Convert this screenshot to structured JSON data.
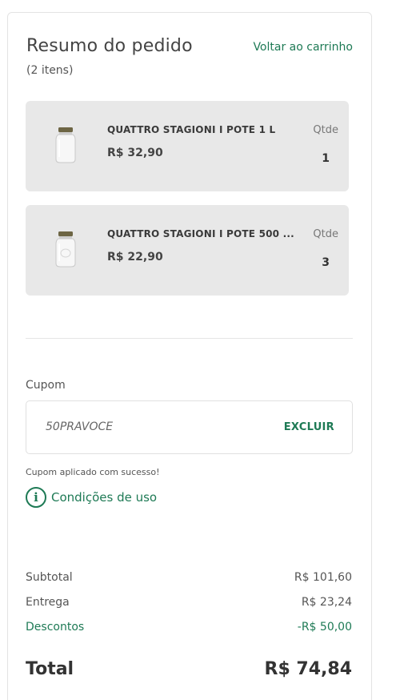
{
  "header": {
    "title": "Resumo do pedido",
    "item_count": "(2 itens)",
    "back_link": "Voltar ao carrinho"
  },
  "items": [
    {
      "name": "QUATTRO STAGIONI I POTE 1 L",
      "price": "R$ 32,90",
      "qty_label": "Qtde",
      "qty": "1",
      "icon": "glass-jar-icon"
    },
    {
      "name": "QUATTRO STAGIONI I POTE 500 ...",
      "price": "R$ 22,90",
      "qty_label": "Qtde",
      "qty": "3",
      "icon": "glass-jar-icon"
    }
  ],
  "coupon": {
    "label": "Cupom",
    "code": "50PRAVOCE",
    "remove_label": "EXCLUIR",
    "success_message": "Cupom aplicado com sucesso!",
    "conditions_label": "Condições de uso"
  },
  "summary": {
    "subtotal_label": "Subtotal",
    "subtotal_value": "R$ 101,60",
    "delivery_label": "Entrega",
    "delivery_value": "R$ 23,24",
    "discount_label": "Descontos",
    "discount_value": "-R$ 50,00",
    "total_label": "Total",
    "total_value": "R$ 74,84"
  },
  "colors": {
    "accent": "#1e7a55",
    "item_background": "#e8e8e8",
    "border": "#e3e3e3"
  }
}
